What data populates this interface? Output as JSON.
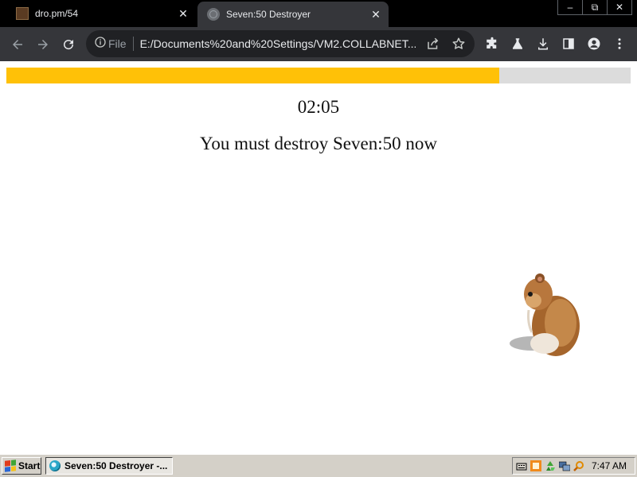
{
  "browser": {
    "tabs": [
      {
        "title": "dro.pm/54",
        "favicon": "dro-favicon-icon",
        "active": false
      },
      {
        "title": "Seven:50 Destroyer",
        "favicon": "globe-icon",
        "active": true
      }
    ],
    "address_bar": {
      "scheme_label": "File",
      "url": "E:/Documents%20and%20Settings/VM2.COLLABNET..."
    }
  },
  "page": {
    "progress": 0.79,
    "progress_color": "#ffc107",
    "timer": "02:05",
    "message": "You must destroy Seven:50 now"
  },
  "taskbar": {
    "start_label": "Start",
    "active_task": "Seven:50 Destroyer -...",
    "clock": "7:47 AM"
  }
}
